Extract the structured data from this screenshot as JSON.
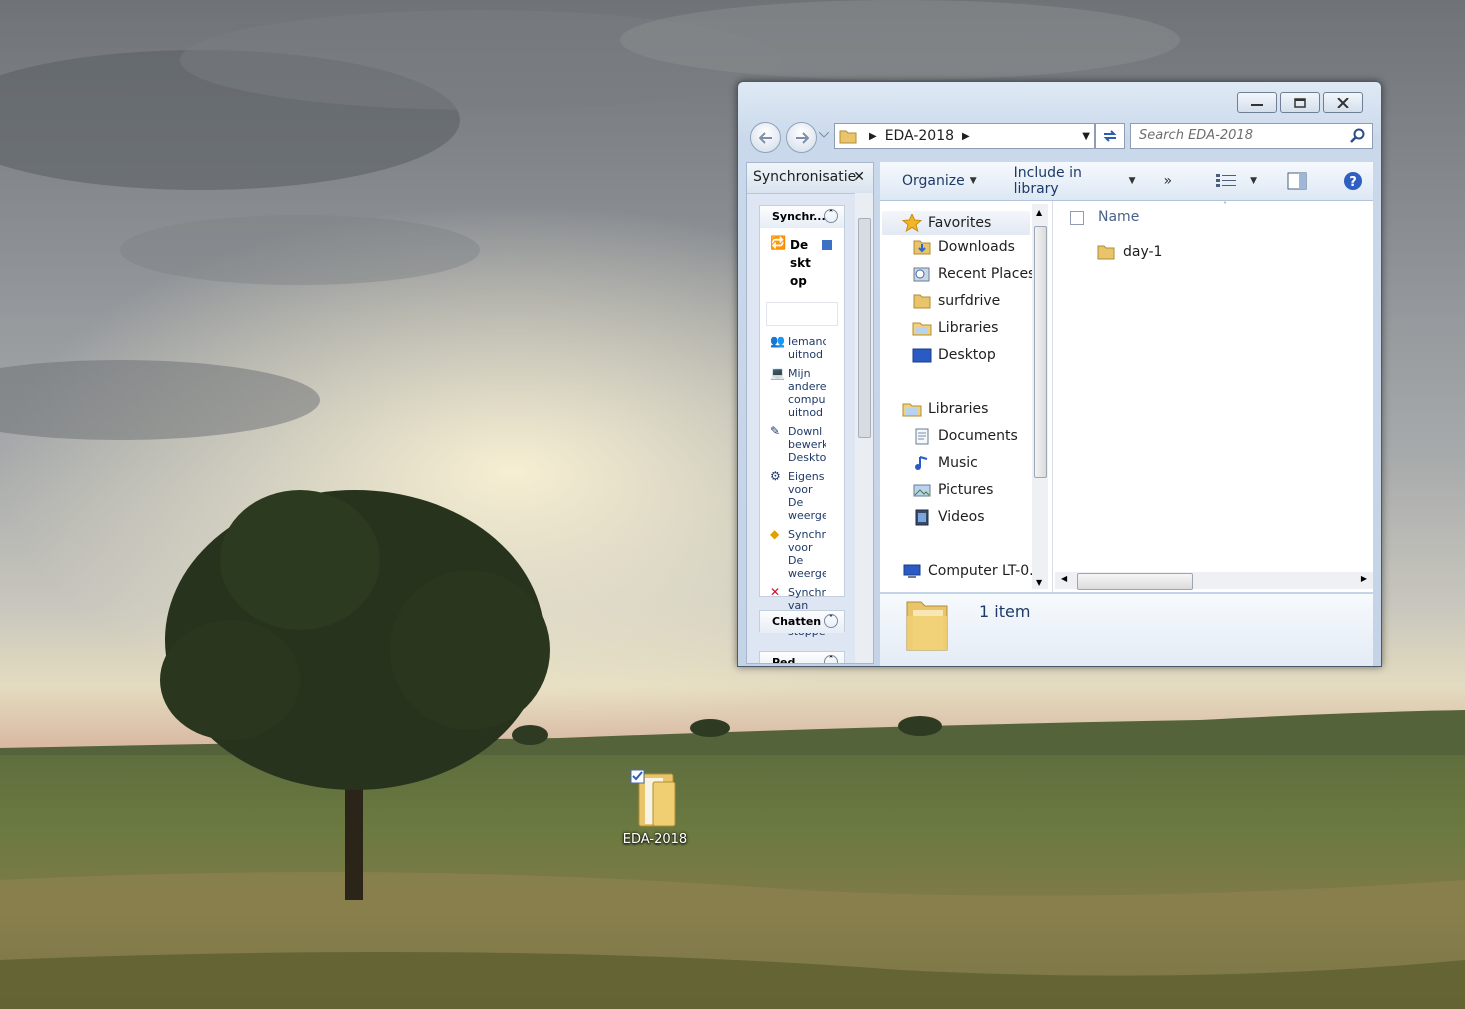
{
  "desktop": {
    "icon_label": "EDA-2018"
  },
  "window": {
    "address": {
      "segments": [
        "EDA-2018"
      ]
    },
    "search_placeholder": "Search EDA-2018",
    "sync_pane": {
      "title": "Synchronisatie",
      "section1_title": "Synchr...",
      "desktop_item": "De skt op",
      "tasks": [
        {
          "icon": "invite-user-icon",
          "label": "Iemand uitnod"
        },
        {
          "icon": "other-computer-icon",
          "label": "Mijn andere compu uitnod"
        },
        {
          "icon": "download-edit-icon",
          "label": "Downl bewerk Deskto"
        },
        {
          "icon": "properties-icon",
          "label": "Eigens voor De weerge"
        },
        {
          "icon": "sync-warning-icon",
          "label": "Synchr voor De weerge"
        },
        {
          "icon": "stop-icon",
          "label": "Synchr van De stoppe"
        }
      ],
      "section2_title": "Chatten",
      "section3_title": "Ped..."
    },
    "toolbar": {
      "organize": "Organize",
      "include_in_library": "Include in library",
      "more": "»"
    },
    "nav_tree": {
      "favorites": {
        "label": "Favorites",
        "items": [
          "Downloads",
          "Recent Places",
          "surfdrive",
          "Libraries",
          "Desktop"
        ]
      },
      "libraries": {
        "label": "Libraries",
        "items": [
          "Documents",
          "Music",
          "Pictures",
          "Videos"
        ]
      },
      "computer": "Computer LT-0..."
    },
    "file_list": {
      "column_name": "Name",
      "items": [
        {
          "name": "day-1",
          "icon": "folder-icon"
        }
      ]
    },
    "details": {
      "item_count": "1 item"
    }
  }
}
